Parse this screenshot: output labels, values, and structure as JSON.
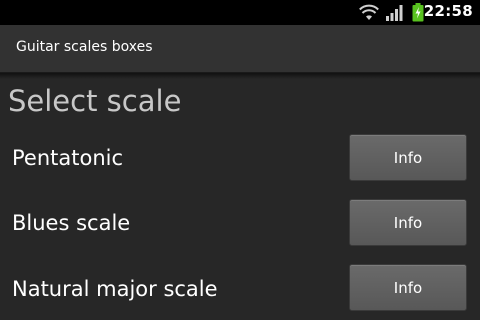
{
  "status_bar": {
    "time": "22:58",
    "wifi_icon": "wifi-icon",
    "signal_icon": "signal-bars-icon",
    "battery_icon": "battery-charging-icon",
    "battery_color": "#58c21f"
  },
  "app": {
    "title": "Guitar scales boxes"
  },
  "main": {
    "heading": "Select scale",
    "scales": [
      {
        "label": "Pentatonic",
        "button_label": "Info"
      },
      {
        "label": "Blues scale",
        "button_label": "Info"
      },
      {
        "label": "Natural major scale",
        "button_label": "Info"
      }
    ]
  }
}
